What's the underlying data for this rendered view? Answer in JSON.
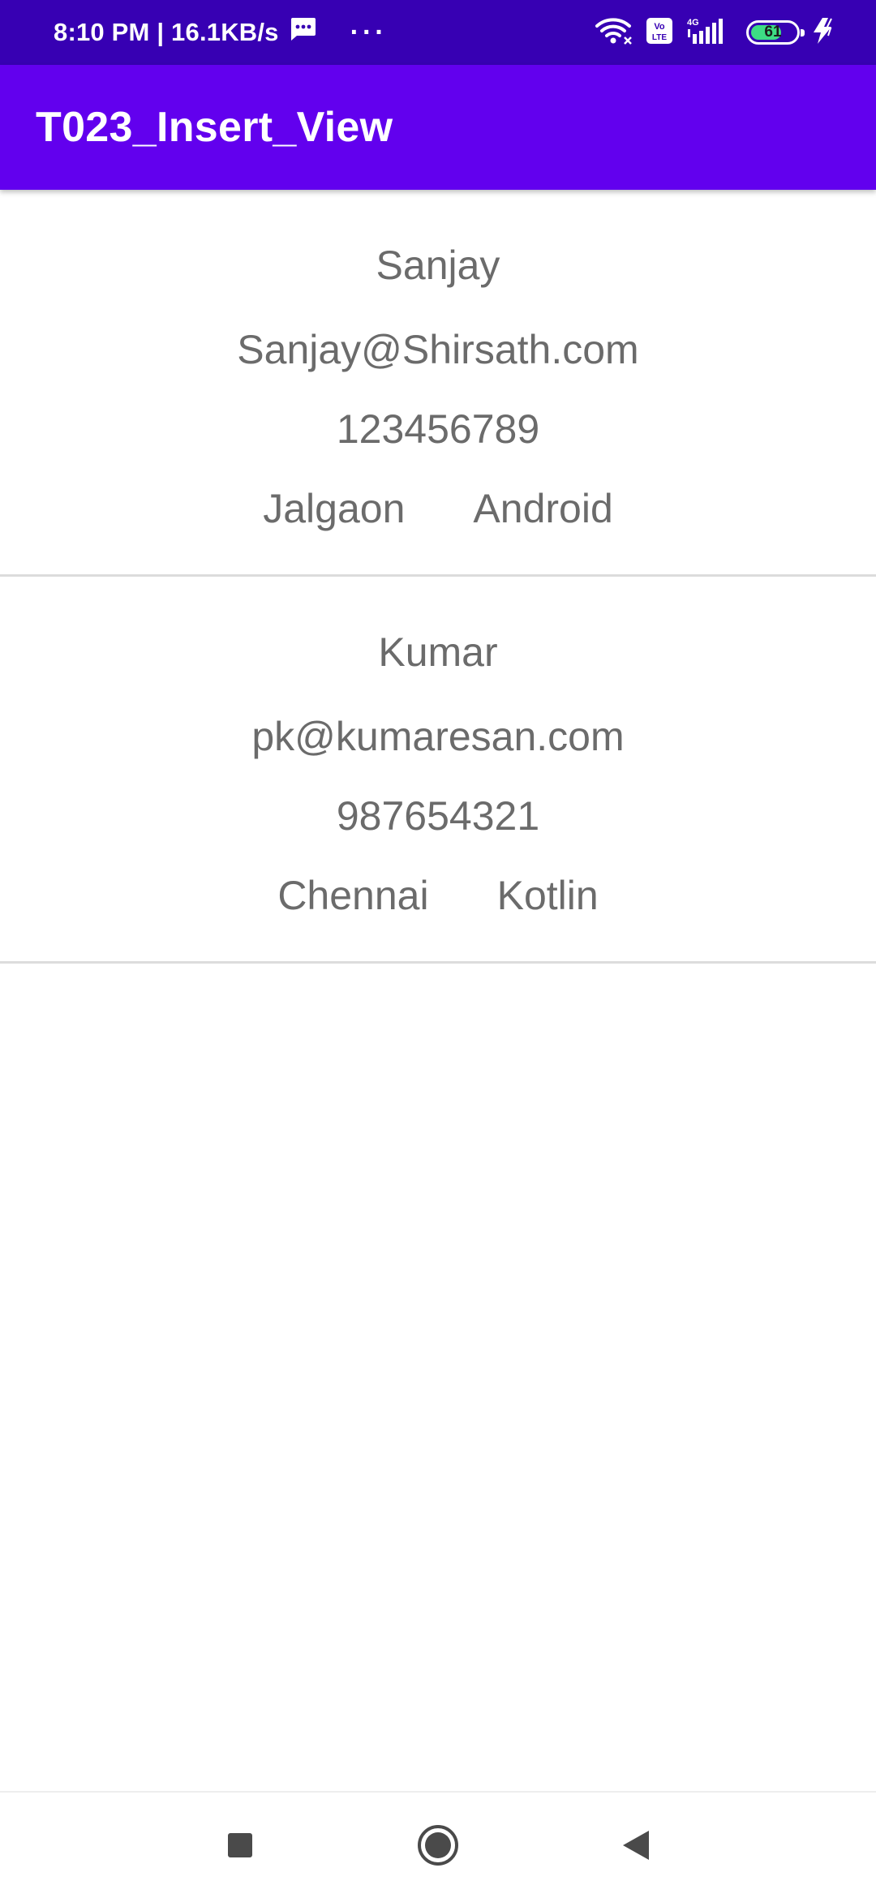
{
  "status_bar": {
    "time_speed": "8:10 PM | 16.1KB/s",
    "more": "···",
    "volte_label": "Vo LTE",
    "network_label": "4G",
    "battery": "61",
    "battery_level": 0.61
  },
  "app_bar": {
    "title": "T023_Insert_View"
  },
  "records": [
    {
      "name": "Sanjay",
      "email": "Sanjay@Shirsath.com",
      "phone": "123456789",
      "city": "Jalgaon",
      "course": "Android"
    },
    {
      "name": "Kumar",
      "email": "pk@kumaresan.com",
      "phone": "987654321",
      "city": "Chennai",
      "course": "Kotlin"
    }
  ],
  "nav_bar": {
    "icons": [
      "recents-icon",
      "home-icon",
      "back-icon"
    ]
  },
  "colors": {
    "status_bar": "#3700b3",
    "app_bar": "#6200ee",
    "text": "#6b6b6b",
    "divider": "#dcdcdc"
  }
}
